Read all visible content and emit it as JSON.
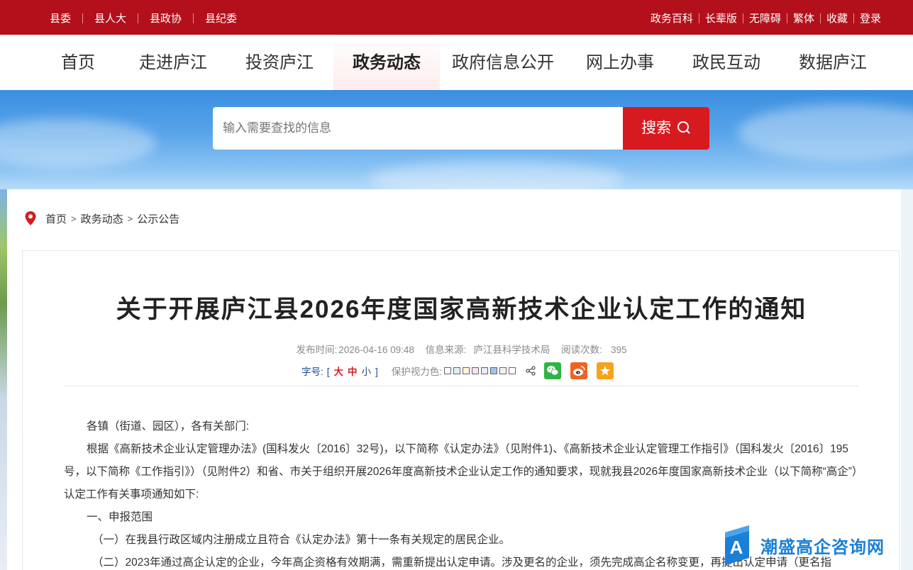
{
  "topbar": {
    "left_links": [
      "县委",
      "县人大",
      "县政协",
      "县纪委"
    ],
    "right_links": [
      "政务百科",
      "长辈版",
      "无障碍",
      "繁体",
      "收藏",
      "登录"
    ]
  },
  "nav": {
    "items": [
      "首页",
      "走进庐江",
      "投资庐江",
      "政务动态",
      "政府信息公开",
      "网上办事",
      "政民互动",
      "数据庐江"
    ],
    "active": "政务动态"
  },
  "search": {
    "placeholder": "输入需要查找的信息",
    "button_label": "搜索"
  },
  "breadcrumb": [
    "首页",
    "政务动态",
    "公示公告"
  ],
  "article": {
    "title": "关于开展庐江县2026年度国家高新技术企业认定工作的通知",
    "publish_label": "发布时间:",
    "publish_time": "2026-04-16 09:48",
    "source_label": "信息来源:",
    "source": "庐江县科学技术局",
    "views_label": "阅读次数:",
    "views": "395",
    "font_label": "字号:",
    "font_open": "[",
    "font_large": "大",
    "font_medium": "中",
    "font_small": "小",
    "font_close": "]",
    "eye_label": "保护视力色:",
    "eye_colors": [
      "#ffffff",
      "#d9f2f2",
      "#fff5d6",
      "#fbe1f2",
      "#e3ecf7",
      "#9fc4ee",
      "#f2f2f2",
      "#ffffff"
    ],
    "paragraphs": [
      "各镇（街道、园区），各有关部门:",
      "根据《高新技术企业认定管理办法》(国科发火〔2016〕32号)，以下简称《认定办法》（见附件1)、《高新技术企业认定管理工作指引》（国科发火〔2016〕195号，以下简称《工作指引》）（见附件2）和省、市关于组织开展2026年度高新技术企业认定工作的通知要求，现就我县2026年度国家高新技术企业（以下简称“高企”）认定工作有关事项通知如下:",
      "一、申报范围",
      "（一）在我县行政区域内注册成立且符合《认定办法》第十一条有关规定的居民企业。",
      "（二）2023年通过高企认定的企业，今年高企资格有效期满，需重新提出认定申请。涉及更名的企业，须先完成高企名称变更，再提出认定申请（更名指"
    ]
  },
  "watermark": {
    "text": "潮盛高企咨询网",
    "logo_letter": "A"
  },
  "colors": {
    "brand_red": "#b3101b",
    "button_red": "#d71a1f",
    "link_blue": "#1a4a8e"
  }
}
